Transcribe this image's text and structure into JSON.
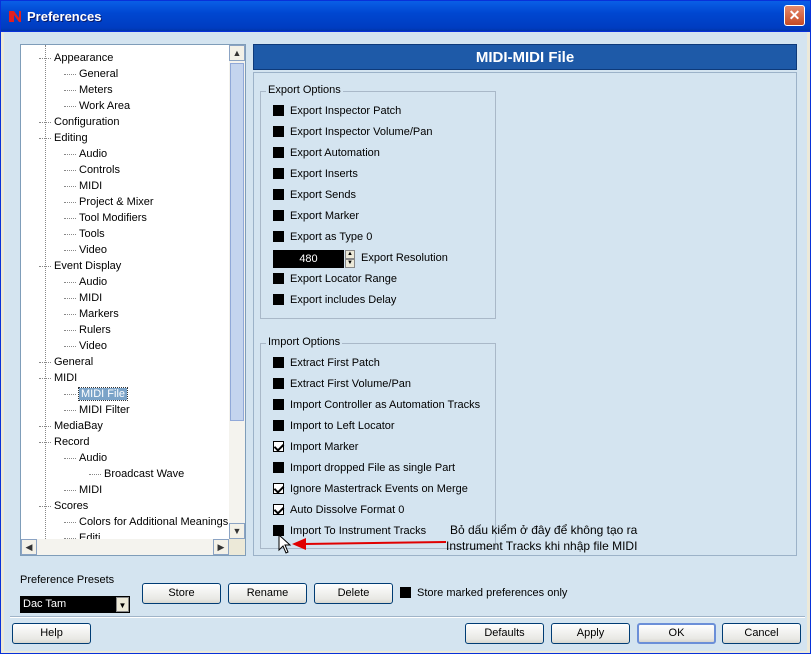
{
  "window": {
    "title": "Preferences",
    "close_label": "✕"
  },
  "tree": {
    "items": [
      {
        "label": "Appearance",
        "level": 1
      },
      {
        "label": "General",
        "level": 2
      },
      {
        "label": "Meters",
        "level": 2
      },
      {
        "label": "Work Area",
        "level": 2
      },
      {
        "label": "Configuration",
        "level": 1
      },
      {
        "label": "Editing",
        "level": 1
      },
      {
        "label": "Audio",
        "level": 2
      },
      {
        "label": "Controls",
        "level": 2
      },
      {
        "label": "MIDI",
        "level": 2
      },
      {
        "label": "Project & Mixer",
        "level": 2
      },
      {
        "label": "Tool Modifiers",
        "level": 2
      },
      {
        "label": "Tools",
        "level": 2
      },
      {
        "label": "Video",
        "level": 2
      },
      {
        "label": "Event Display",
        "level": 1
      },
      {
        "label": "Audio",
        "level": 2
      },
      {
        "label": "MIDI",
        "level": 2
      },
      {
        "label": "Markers",
        "level": 2
      },
      {
        "label": "Rulers",
        "level": 2
      },
      {
        "label": "Video",
        "level": 2
      },
      {
        "label": "General",
        "level": 1
      },
      {
        "label": "MIDI",
        "level": 1
      },
      {
        "label": "MIDI File",
        "level": 2,
        "selected": true
      },
      {
        "label": "MIDI Filter",
        "level": 2
      },
      {
        "label": "MediaBay",
        "level": 1
      },
      {
        "label": "Record",
        "level": 1
      },
      {
        "label": "Audio",
        "level": 2
      },
      {
        "label": "Broadcast Wave",
        "level": 3
      },
      {
        "label": "MIDI",
        "level": 2
      },
      {
        "label": "Scores",
        "level": 1
      },
      {
        "label": "Colors for Additional Meanings",
        "level": 2
      },
      {
        "label": "Editi...",
        "level": 2
      }
    ]
  },
  "panel": {
    "title": "MIDI-MIDI File",
    "export": {
      "title": "Export Options",
      "options": [
        {
          "label": "Export Inspector Patch",
          "checked": false
        },
        {
          "label": "Export Inspector Volume/Pan",
          "checked": false
        },
        {
          "label": "Export Automation",
          "checked": false
        },
        {
          "label": "Export Inserts",
          "checked": false
        },
        {
          "label": "Export Sends",
          "checked": false
        },
        {
          "label": "Export Marker",
          "checked": false
        },
        {
          "label": "Export as Type 0",
          "checked": false
        }
      ],
      "resolution_value": "480",
      "resolution_label": "Export Resolution",
      "options2": [
        {
          "label": "Export Locator Range",
          "checked": false
        },
        {
          "label": "Export includes Delay",
          "checked": false
        }
      ]
    },
    "import": {
      "title": "Import Options",
      "options": [
        {
          "label": "Extract First Patch",
          "checked": false
        },
        {
          "label": "Extract First Volume/Pan",
          "checked": false
        },
        {
          "label": "Import Controller as Automation Tracks",
          "checked": false
        },
        {
          "label": "Import to Left Locator",
          "checked": false
        },
        {
          "label": "Import Marker",
          "checked": true
        },
        {
          "label": "Import dropped File as single Part",
          "checked": false
        },
        {
          "label": "Ignore Mastertrack Events on Merge",
          "checked": true
        },
        {
          "label": "Auto Dissolve Format 0",
          "checked": true
        },
        {
          "label": "Import To Instrument Tracks",
          "checked": false
        }
      ]
    }
  },
  "annotation": {
    "line1": "Bỏ dấu kiểm ở đây để không tạo ra",
    "line2": "Instrument Tracks khi nhập file MIDI",
    "color": "#e00000"
  },
  "presets": {
    "label": "Preference Presets",
    "selected": "Dac Tam",
    "store": "Store",
    "rename": "Rename",
    "delete": "Delete",
    "store_marked": "Store marked preferences only"
  },
  "footer": {
    "help": "Help",
    "defaults": "Defaults",
    "apply": "Apply",
    "ok": "OK",
    "cancel": "Cancel"
  }
}
